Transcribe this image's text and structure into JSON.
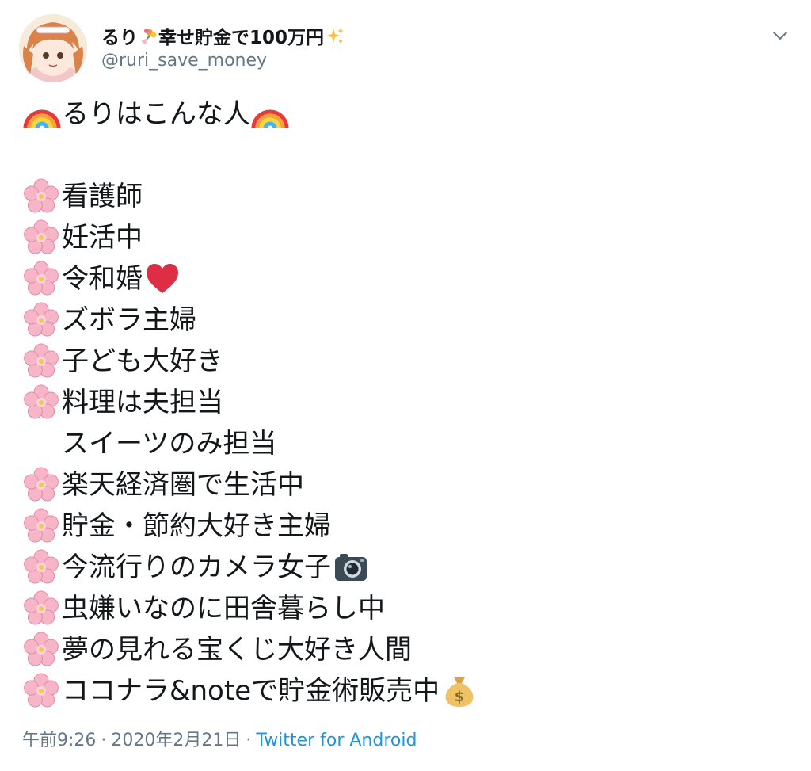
{
  "user": {
    "display_name_prefix": "るり",
    "display_name_suffix": "幸せ貯金で100万円",
    "handle": "@ruri_save_money",
    "name_icons": [
      "bouquet-icon",
      "sparkles-icon"
    ]
  },
  "tweet": {
    "title": "るりはこんな人",
    "lines": [
      "看護師",
      "妊活中",
      "令和婚",
      "ズボラ主婦",
      "子ども大好き",
      "料理は夫担当",
      "スイーツのみ担当",
      "楽天経済圏で生活中",
      "貯金・節約大好き主婦",
      "今流行りのカメラ女子",
      "虫嫌いなのに田舎暮らし中",
      "夢の見れる宝くじ大好き人間",
      "ココナラ&noteで貯金術販売中"
    ],
    "bullet_icon": "cherry-blossom-icon",
    "title_icon": "rainbow-icon"
  },
  "meta": {
    "time": "午前9:26",
    "date": "2020年2月21日",
    "separator": "·",
    "source": "Twitter for Android"
  },
  "colors": {
    "text": "#14171a",
    "secondary": "#657786",
    "link": "#1b95e0"
  }
}
